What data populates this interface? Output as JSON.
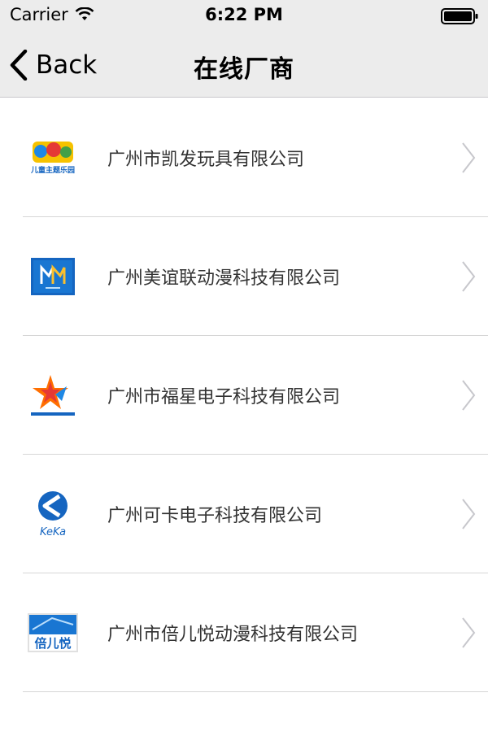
{
  "status_bar": {
    "carrier": "Carrier",
    "time": "6:22 PM"
  },
  "nav": {
    "back_label": "Back",
    "title": "在线厂商"
  },
  "vendors": [
    {
      "name": "广州市凯发玩具有限公司",
      "logo_icon": "kids-theme-park-logo-icon",
      "logo_caption": "儿童主题乐园"
    },
    {
      "name": "广州美谊联动漫科技有限公司",
      "logo_icon": "meiyilian-logo-icon"
    },
    {
      "name": "广州市福星电子科技有限公司",
      "logo_icon": "fuxing-star-logo-icon"
    },
    {
      "name": "广州可卡电子科技有限公司",
      "logo_icon": "keka-logo-icon",
      "logo_caption": "KeKa"
    },
    {
      "name": "广州市倍儿悦动漫科技有限公司",
      "logo_icon": "beiery-logo-icon",
      "logo_caption": "倍儿悦"
    }
  ],
  "colors": {
    "bar_background": "#ececec",
    "separator": "#d6d6d6",
    "chevron": "#c7c7cc"
  }
}
